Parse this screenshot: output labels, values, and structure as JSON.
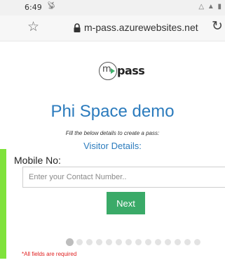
{
  "status_bar": {
    "time": "6:49",
    "cast_icon": "cast-icon",
    "signal_icons": "wifi-icon signal-icon battery-icon"
  },
  "browser": {
    "url": "m-pass.azurewebsites.net",
    "bookmark_icon": "star-outline-icon",
    "secure_icon": "lock-icon",
    "reload_icon": "reload-icon"
  },
  "logo": {
    "letter": "m",
    "wordmark": "pass",
    "accent_color": "#3db36b"
  },
  "form": {
    "title": "Phi Space demo",
    "subtitle": "Fill the below details to create a pass:",
    "section_heading": "Visitor Details:",
    "mobile_label": "Mobile No:",
    "mobile_placeholder": "Enter your Contact Number..",
    "mobile_value": "",
    "next_label": "Next",
    "required_note": "*All fields are required"
  },
  "progress": {
    "total_steps": 14,
    "current_step": 1
  },
  "colors": {
    "title_blue": "#2b7bbd",
    "button_green": "#3aaa68",
    "strip_green": "#7fe23b",
    "error_red": "#e02020"
  }
}
